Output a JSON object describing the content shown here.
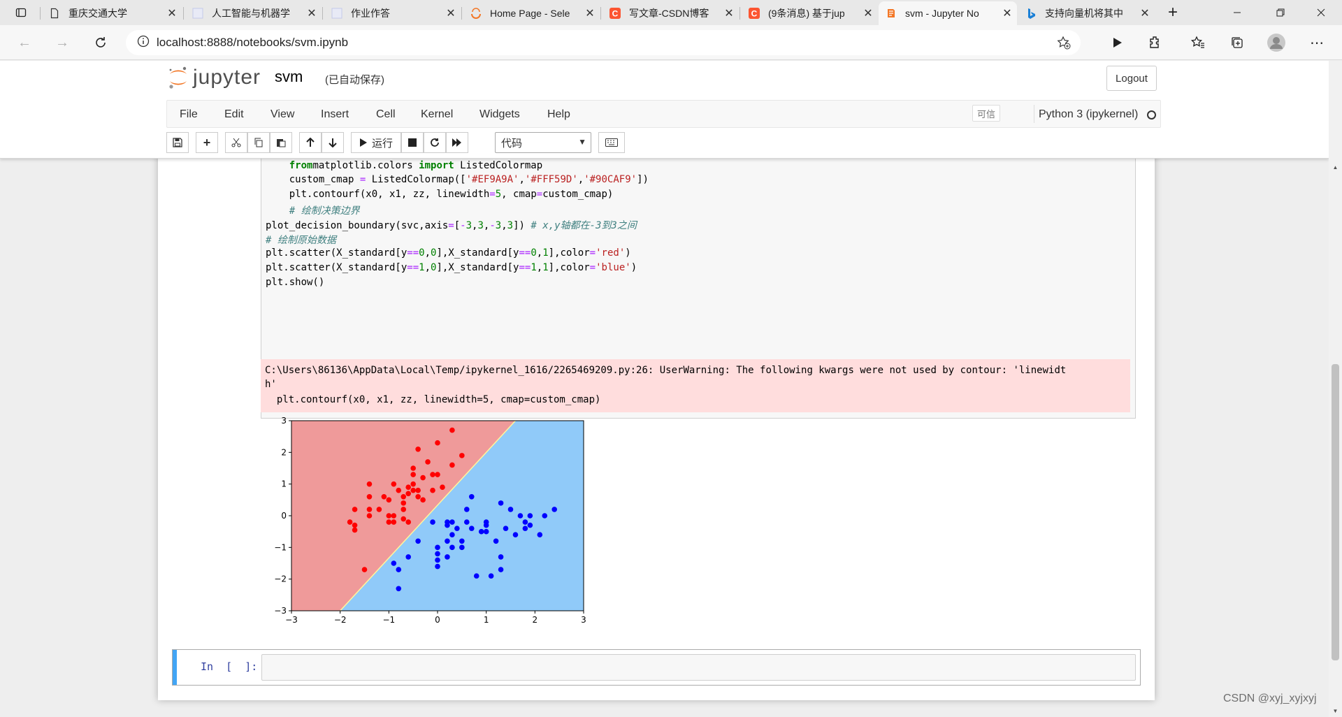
{
  "browser": {
    "tabs": [
      {
        "title": "重庆交通大学",
        "icon": "page-icon"
      },
      {
        "title": "人工智能与机器学",
        "icon": "doc-icon"
      },
      {
        "title": "作业作答",
        "icon": "doc-icon"
      },
      {
        "title": "Home Page - Sele",
        "icon": "selenium-icon"
      },
      {
        "title": "写文章-CSDN博客",
        "icon": "csdn-icon"
      },
      {
        "title": "(9条消息) 基于jup",
        "icon": "csdn-icon"
      },
      {
        "title": "svm - Jupyter No",
        "icon": "jupyter-icon"
      },
      {
        "title": "支持向量机将其中",
        "icon": "bing-icon"
      }
    ],
    "url": "localhost:8888/notebooks/svm.ipynb",
    "colors": {
      "csdn": "#fc5531",
      "jupyter": "#f37726",
      "bing": "#1a7fd6"
    }
  },
  "jupyter": {
    "logo_text": "jupyter",
    "notebook_name": "svm",
    "autosave_status": "(已自动保存)",
    "logout_label": "Logout",
    "menu": [
      "File",
      "Edit",
      "View",
      "Insert",
      "Cell",
      "Kernel",
      "Widgets",
      "Help"
    ],
    "trusted_label": "可信",
    "kernel_name": "Python 3 (ipykernel)",
    "toolbar": {
      "run_label": "运行",
      "cell_type": "代码"
    }
  },
  "code_lines": [
    {
      "indent": "    ",
      "segments": [
        [
          "kw",
          "from"
        ],
        [
          "",
          "matplotlib.colors "
        ],
        [
          "kw",
          "import"
        ],
        [
          "",
          " ListedColormap"
        ]
      ]
    },
    {
      "indent": "    ",
      "segments": [
        [
          "",
          "custom_cmap "
        ],
        [
          "op",
          "="
        ],
        [
          "",
          " ListedColormap(["
        ],
        [
          "st",
          "'#EF9A9A'"
        ],
        [
          "",
          ","
        ],
        [
          "st",
          "'#FFF59D'"
        ],
        [
          "",
          ","
        ],
        [
          "st",
          "'#90CAF9'"
        ],
        [
          "",
          "])"
        ]
      ]
    },
    {
      "indent": "    ",
      "segments": [
        [
          "",
          "plt.contourf(x0, x1, zz, linewidth"
        ],
        [
          "op",
          "="
        ],
        [
          "nu",
          "5"
        ],
        [
          "",
          ", cmap"
        ],
        [
          "op",
          "="
        ],
        [
          "",
          "custom_cmap)"
        ]
      ]
    },
    {
      "indent": "    ",
      "segments": [
        [
          "cm",
          "# 绘制决策边界"
        ]
      ]
    },
    {
      "indent": "",
      "segments": [
        [
          "",
          "plot_decision_boundary(svc,axis"
        ],
        [
          "op",
          "="
        ],
        [
          "",
          "["
        ],
        [
          "op",
          "-"
        ],
        [
          "nu",
          "3"
        ],
        [
          "",
          ","
        ],
        [
          "nu",
          "3"
        ],
        [
          "",
          ","
        ],
        [
          "op",
          "-"
        ],
        [
          "nu",
          "3"
        ],
        [
          "",
          ","
        ],
        [
          "nu",
          "3"
        ],
        [
          "",
          "]) "
        ],
        [
          "cm",
          "# x,y轴都在-3到3之间"
        ]
      ]
    },
    {
      "indent": "",
      "segments": [
        [
          "cm",
          "# 绘制原始数据"
        ]
      ]
    },
    {
      "indent": "",
      "segments": [
        [
          "",
          "plt.scatter(X_standard[y"
        ],
        [
          "op",
          "=="
        ],
        [
          "nu",
          "0"
        ],
        [
          "",
          ","
        ],
        [
          "nu",
          "0"
        ],
        [
          "",
          "],X_standard[y"
        ],
        [
          "op",
          "=="
        ],
        [
          "nu",
          "0"
        ],
        [
          "",
          ","
        ],
        [
          "nu",
          "1"
        ],
        [
          "",
          "],color"
        ],
        [
          "op",
          "="
        ],
        [
          "st",
          "'red'"
        ],
        [
          "",
          ")"
        ]
      ]
    },
    {
      "indent": "",
      "segments": [
        [
          "",
          "plt.scatter(X_standard[y"
        ],
        [
          "op",
          "=="
        ],
        [
          "nu",
          "1"
        ],
        [
          "",
          ","
        ],
        [
          "nu",
          "0"
        ],
        [
          "",
          "],X_standard[y"
        ],
        [
          "op",
          "=="
        ],
        [
          "nu",
          "1"
        ],
        [
          "",
          ","
        ],
        [
          "nu",
          "1"
        ],
        [
          "",
          "],color"
        ],
        [
          "op",
          "="
        ],
        [
          "st",
          "'blue'"
        ],
        [
          "",
          ")"
        ]
      ]
    },
    {
      "indent": "",
      "segments": [
        [
          "",
          "plt.show()"
        ]
      ]
    }
  ],
  "stderr_lines": [
    "C:\\Users\\86136\\AppData\\Local\\Temp/ipykernel_1616/2265469209.py:26: UserWarning: The following kwargs were not used by contour: 'linewidt",
    "h'",
    "  plt.contourf(x0, x1, zz, linewidth=5, cmap=custom_cmap)"
  ],
  "new_cell_prompt": "In  [  ]:",
  "watermark": "CSDN @xyj_xyjxyj",
  "chart_data": {
    "type": "scatter",
    "xlim": [
      -3,
      3
    ],
    "ylim": [
      -3,
      3
    ],
    "xticks": [
      "−3",
      "−2",
      "−1",
      "0",
      "1",
      "2",
      "3"
    ],
    "yticks": [
      "−3",
      "−2",
      "−1",
      "0",
      "1",
      "2",
      "3"
    ],
    "background_regions": {
      "class0_color": "#EF9A9A",
      "class1_color": "#90CAF9",
      "boundary": "diagonal from (-2.0,-3) to (1.6,3)"
    },
    "series": [
      {
        "color": "#ff0000",
        "points": [
          [
            -1.8,
            -0.2
          ],
          [
            -1.7,
            -0.3
          ],
          [
            -1.7,
            -0.45
          ],
          [
            -1.7,
            0.2
          ],
          [
            -1.4,
            0.0
          ],
          [
            -1.4,
            0.6
          ],
          [
            -1.4,
            0.2
          ],
          [
            -1.4,
            1.0
          ],
          [
            -1.2,
            0.2
          ],
          [
            -1.1,
            0.6
          ],
          [
            -1.0,
            0.0
          ],
          [
            -1.0,
            -0.2
          ],
          [
            -1.0,
            0.5
          ],
          [
            -0.9,
            1.0
          ],
          [
            -0.9,
            -0.2
          ],
          [
            -0.9,
            0.0
          ],
          [
            -0.8,
            0.8
          ],
          [
            -0.7,
            0.6
          ],
          [
            -0.7,
            0.4
          ],
          [
            -0.7,
            0.2
          ],
          [
            -0.7,
            -0.1
          ],
          [
            -0.6,
            0.7
          ],
          [
            -0.6,
            0.9
          ],
          [
            -0.6,
            -0.2
          ],
          [
            -0.5,
            0.8
          ],
          [
            -0.5,
            1.0
          ],
          [
            -0.5,
            1.3
          ],
          [
            -0.5,
            1.5
          ],
          [
            -0.4,
            0.8
          ],
          [
            -0.4,
            0.6
          ],
          [
            -0.4,
            2.1
          ],
          [
            -0.3,
            1.2
          ],
          [
            -0.3,
            0.5
          ],
          [
            -0.2,
            1.7
          ],
          [
            -0.1,
            1.3
          ],
          [
            -0.1,
            0.8
          ],
          [
            0.0,
            2.3
          ],
          [
            0.0,
            1.3
          ],
          [
            0.1,
            0.9
          ],
          [
            0.3,
            1.6
          ],
          [
            0.3,
            2.7
          ],
          [
            0.5,
            1.9
          ],
          [
            -1.5,
            -1.7
          ]
        ]
      },
      {
        "color": "#0000ff",
        "points": [
          [
            -0.9,
            -1.5
          ],
          [
            -0.8,
            -2.3
          ],
          [
            -0.8,
            -1.7
          ],
          [
            -0.6,
            -1.3
          ],
          [
            -0.4,
            -0.8
          ],
          [
            -0.1,
            -0.2
          ],
          [
            0.0,
            -1.2
          ],
          [
            0.0,
            -1.4
          ],
          [
            0.0,
            -1.0
          ],
          [
            0.0,
            -1.6
          ],
          [
            0.2,
            -1.3
          ],
          [
            0.2,
            -0.8
          ],
          [
            0.2,
            -0.3
          ],
          [
            0.2,
            -0.2
          ],
          [
            0.3,
            -0.6
          ],
          [
            0.3,
            -0.2
          ],
          [
            0.3,
            -1.0
          ],
          [
            0.4,
            -0.4
          ],
          [
            0.5,
            -1.0
          ],
          [
            0.5,
            -0.8
          ],
          [
            0.6,
            0.2
          ],
          [
            0.6,
            -0.2
          ],
          [
            0.7,
            0.6
          ],
          [
            0.7,
            -0.4
          ],
          [
            0.8,
            -1.9
          ],
          [
            0.9,
            -0.5
          ],
          [
            1.0,
            -0.3
          ],
          [
            1.0,
            -0.5
          ],
          [
            1.0,
            -0.2
          ],
          [
            1.1,
            -1.9
          ],
          [
            1.2,
            -0.8
          ],
          [
            1.3,
            -1.3
          ],
          [
            1.3,
            -1.7
          ],
          [
            1.3,
            0.4
          ],
          [
            1.4,
            -0.4
          ],
          [
            1.5,
            0.2
          ],
          [
            1.6,
            -0.6
          ],
          [
            1.7,
            0.0
          ],
          [
            1.8,
            -0.2
          ],
          [
            1.8,
            -0.4
          ],
          [
            1.9,
            -0.3
          ],
          [
            1.9,
            0.0
          ],
          [
            2.1,
            -0.6
          ],
          [
            2.2,
            0.0
          ],
          [
            2.4,
            0.2
          ]
        ]
      }
    ]
  }
}
